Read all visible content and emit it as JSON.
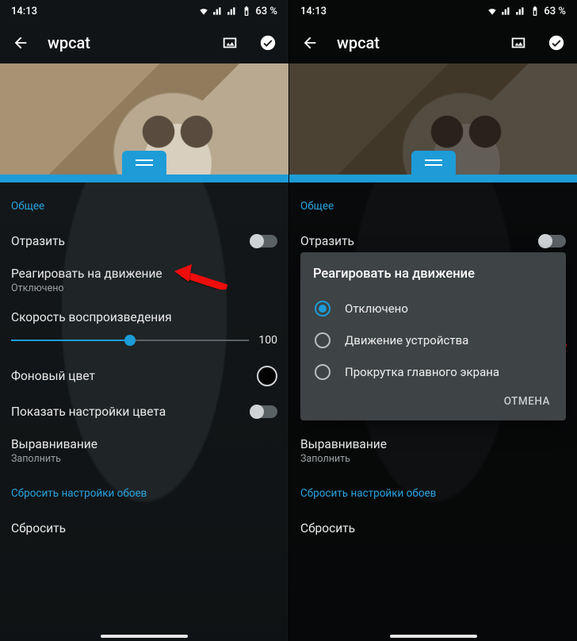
{
  "status": {
    "time": "14:13",
    "battery": "63 %"
  },
  "toolbar": {
    "title": "wpcat"
  },
  "sections": {
    "general": "Общее",
    "reset": "Сбросить настройки обоев"
  },
  "settings": {
    "mirror": {
      "label": "Отразить"
    },
    "motion": {
      "label": "Реагировать на движение",
      "value": "Отключено"
    },
    "speed": {
      "label": "Скорость воспроизведения",
      "value": "100"
    },
    "bgcolor": {
      "label": "Фоновый цвет"
    },
    "colorSettings": {
      "label": "Показать настройки цвета"
    },
    "align": {
      "label": "Выравнивание",
      "value": "Заполнить"
    },
    "reset": {
      "label": "Сбросить"
    }
  },
  "dialog": {
    "title": "Реагировать на движение",
    "options": [
      "Отключено",
      "Движение устройства",
      "Прокрутка главного экрана"
    ],
    "cancel": "ОТМЕНА"
  }
}
